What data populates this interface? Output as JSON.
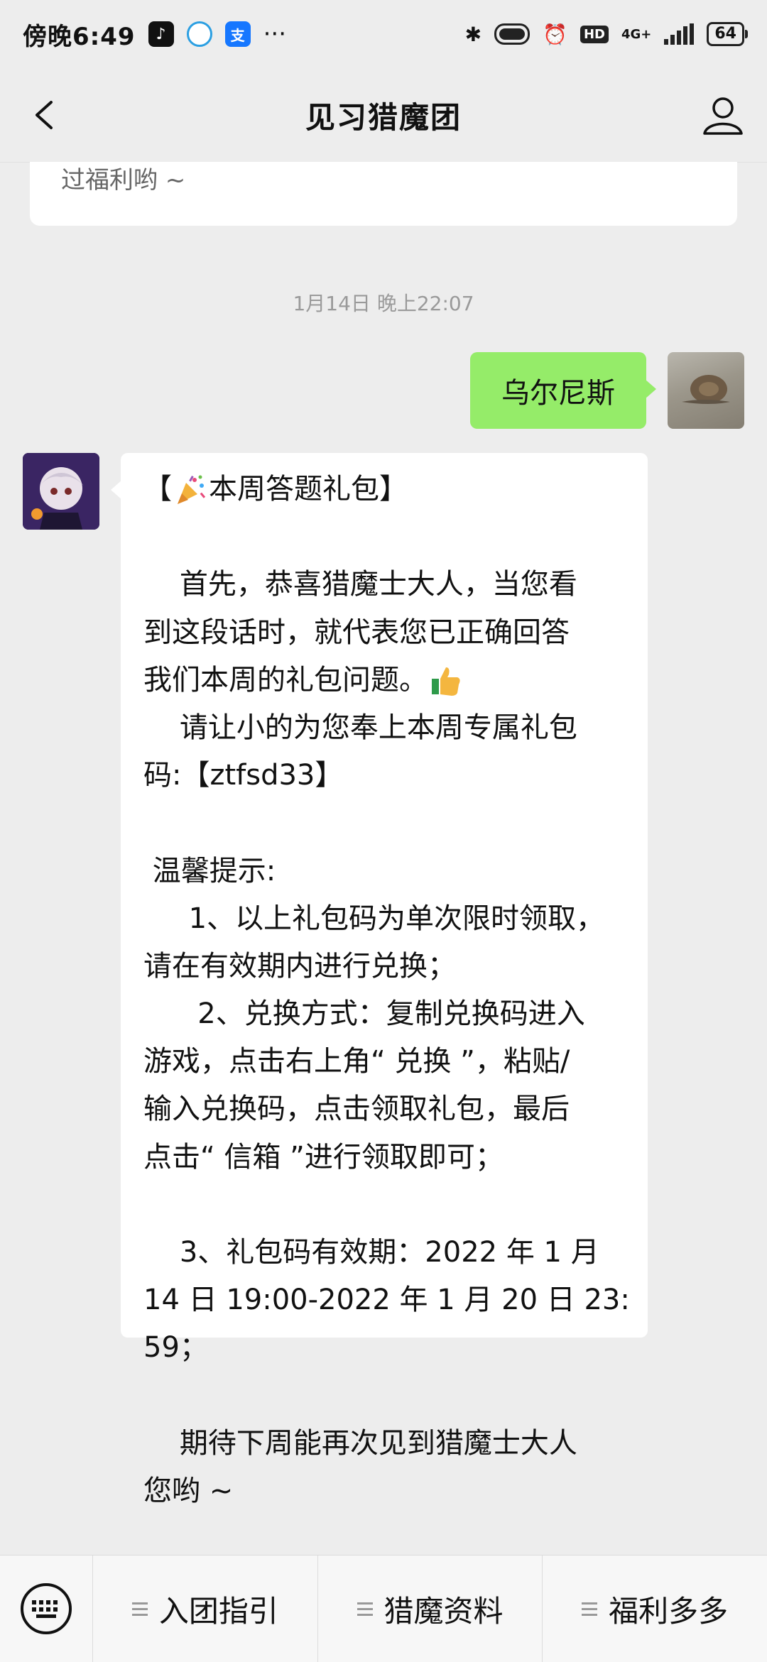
{
  "status_bar": {
    "time": "傍晚6:49",
    "more": "···",
    "network": "4G+",
    "battery": "64"
  },
  "nav": {
    "title": "见习猎魔团"
  },
  "chat": {
    "previous_card_text": "过福利哟 ~",
    "timestamp": "1月14日 晚上22:07",
    "self_message": "乌尔尼斯",
    "bot_message_lines": [
      "【",
      "本周答题礼包】",
      "",
      "    首先，恭喜猎魔士大人，当您看",
      "到这段话时，就代表您已正确回答",
      "我们本周的礼包问题。",
      "    请让小的为您奉上本周专属礼包",
      "码:【ztfsd33】",
      "",
      " 温馨提示:",
      "     1、以上礼包码为单次限时领取，",
      "请在有效期内进行兑换；",
      "      2、兑换方式：复制兑换码进入",
      "游戏，点击右上角“ 兑换 ”，粘贴/",
      "输入兑换码，点击领取礼包，最后",
      "点击“ 信箱 ”进行领取即可；",
      "",
      "    3、礼包码有效期：2022 年 1 月",
      "14 日 19:00-2022 年 1 月 20 日 23:",
      "59；",
      "",
      "    期待下周能再次见到猎魔士大人",
      "您哟 ~"
    ]
  },
  "bottom_menu": {
    "items": [
      "入团指引",
      "猎魔资料",
      "福利多多"
    ]
  },
  "icons": {
    "back": "chevron-left-icon",
    "profile": "person-icon",
    "keyboard": "keyboard-icon",
    "party": "party-popper-icon",
    "thumbs": "thumbs-up-icon"
  }
}
